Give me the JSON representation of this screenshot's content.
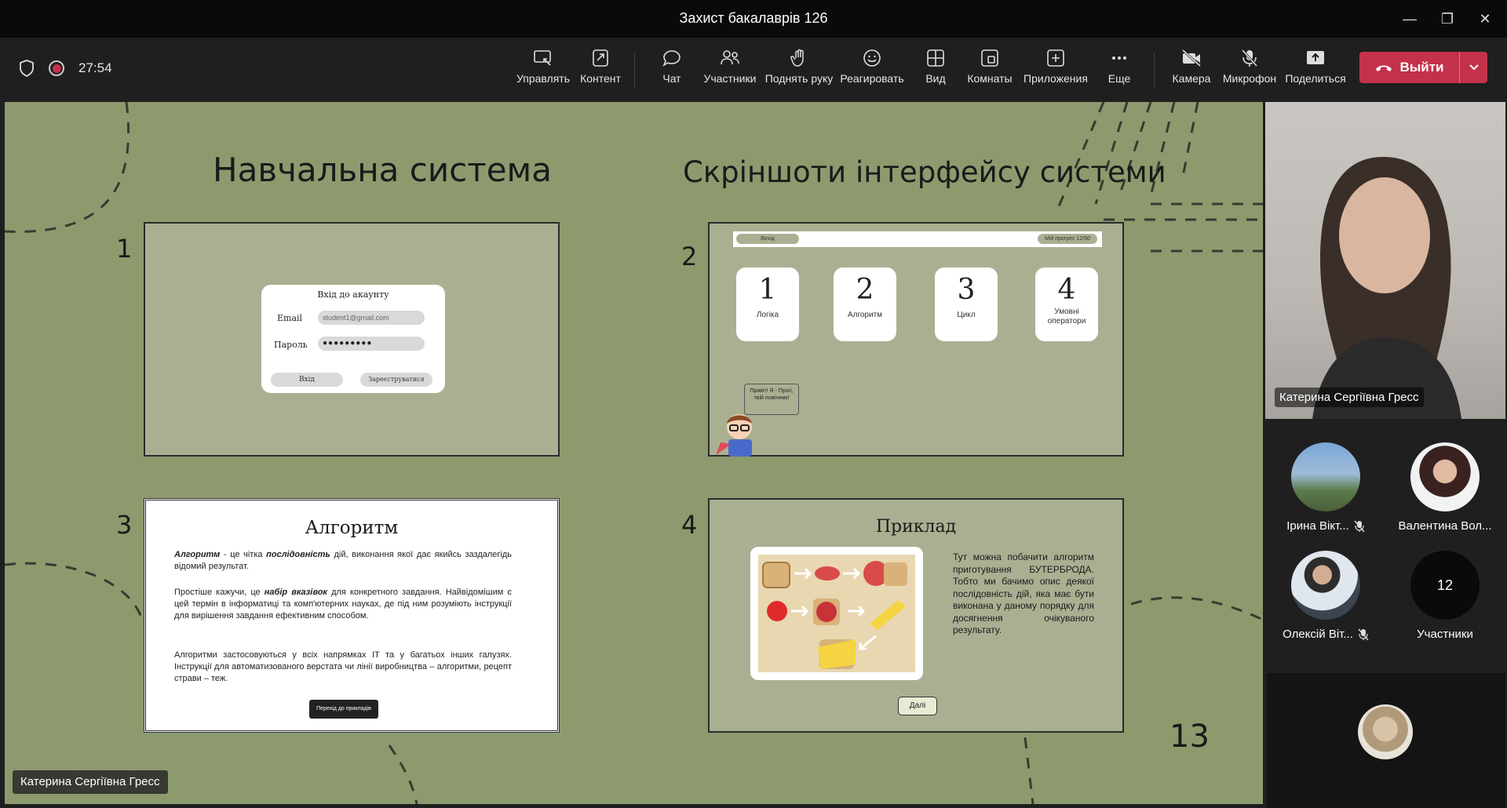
{
  "window": {
    "title": "Захист бакалаврів 126"
  },
  "toolbar": {
    "timer": "27:54",
    "buttons": [
      "Управлять",
      "Контент",
      "Чат",
      "Участники",
      "Поднять руку",
      "Реагировать",
      "Вид",
      "Комнаты",
      "Приложения",
      "Еще",
      "Камера",
      "Микрофон",
      "Поделиться"
    ],
    "leave": "Выйти"
  },
  "slide": {
    "title_left": "Навчальна система",
    "title_right": "Скріншоти інтерфейсу системи",
    "page_number": "13",
    "numbers": [
      "1",
      "2",
      "3",
      "4"
    ],
    "login": {
      "title": "Вхід до акаунту",
      "email_label": "Email",
      "email_value": "student1@gmail.com",
      "password_label": "Пароль",
      "password_value": "●●●●●●●●●",
      "login_btn": "Вхід",
      "register_btn": "Зареєструватися"
    },
    "menu": {
      "exit": "Вихід",
      "progress": "Мій прогрес 12/50",
      "tiles": [
        {
          "num": "1",
          "label": "Логіка"
        },
        {
          "num": "2",
          "label": "Алгоритм"
        },
        {
          "num": "3",
          "label": "Цикл"
        },
        {
          "num": "4",
          "label": "Умовні оператори"
        }
      ],
      "bubble": "Привіт! Я - Прогі, твій помічник!"
    },
    "algorithm": {
      "heading": "Алгоритм",
      "p1_term": "Алгоритм",
      "p1_a": " - це чітка ",
      "p1_em": "послідовність",
      "p1_b": " дій, виконання якої дає якийсь заздалегідь відомий результат.",
      "p2_a": "Простіше кажучи, це ",
      "p2_em": "набір вказівок",
      "p2_b": " для конкретного завдання. Найвідомішим є цей термін в інформатиці та комп'ютерних науках, де під ним розуміють інструкції для вирішення завдання ефективним способом.",
      "p3": "Алгоритми застосовуються у всіх напрямках IT та у багатьох інших галузях. Інструкції для автоматизованого верстата чи лінії виробництва – алгоритми, рецепт страви – теж.",
      "button": "Перехід до прикладів"
    },
    "example": {
      "heading": "Приклад",
      "text": "Тут можна побачити алгоритм приготування БУТЕРБРОДА. Тобто ми бачимо опис деякої послідовність дій, яка має бути виконана у даному порядку для досягнення очікуваного результату.",
      "button": "Далі"
    },
    "speaker_label": "Катерина Сергіївна Гресс"
  },
  "participants": {
    "main_video_name": "Катерина Сергіївна Гресс",
    "list": [
      {
        "name": "Ірина Вікт...",
        "muted": true
      },
      {
        "name": "Валентина Вол...",
        "muted": false
      },
      {
        "name": "Олексій Віт...",
        "muted": true
      }
    ],
    "count": "12",
    "count_label": "Участники"
  },
  "colors": {
    "leave_red": "#c4314b",
    "slide_bg": "#8d9a6e",
    "card_bg": "#a9b092"
  }
}
